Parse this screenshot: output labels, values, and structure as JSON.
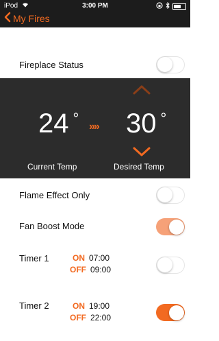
{
  "status_bar": {
    "carrier": "iPod",
    "time": "3:00 PM"
  },
  "nav": {
    "back_label": "My Fires"
  },
  "fireplace_status": {
    "label": "Fireplace Status",
    "on": false
  },
  "temperature": {
    "current_value": "24",
    "desired_value": "30",
    "degree_symbol": "°",
    "arrows": "»»",
    "current_label": "Current Temp",
    "desired_label": "Desired Temp"
  },
  "flame_effect": {
    "label": "Flame Effect Only",
    "on": false
  },
  "fan_boost": {
    "label": "Fan Boost Mode",
    "on": true
  },
  "timer1": {
    "label": "Timer 1",
    "on_label": "ON",
    "on_time": "07:00",
    "off_label": "OFF",
    "off_time": "09:00",
    "enabled": false
  },
  "timer2": {
    "label": "Timer 2",
    "on_label": "ON",
    "on_time": "19:00",
    "off_label": "OFF",
    "off_time": "22:00",
    "enabled": true
  },
  "colors": {
    "accent": "#f26a21",
    "accent_dim": "#f6a178",
    "panel_bg": "#2c2c2c",
    "bar_bg": "#1c1c1c"
  }
}
